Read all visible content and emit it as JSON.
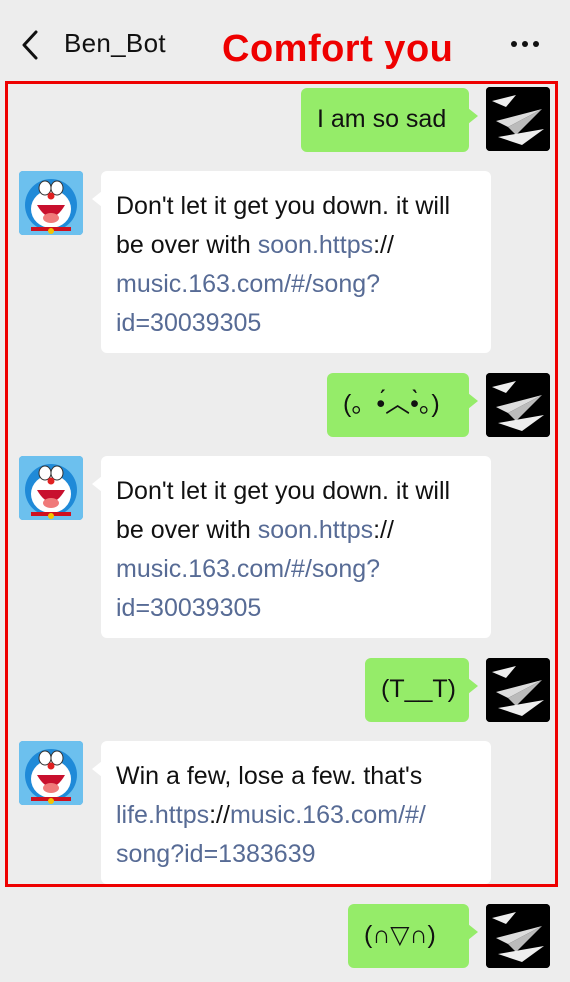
{
  "header": {
    "title": "Ben_Bot",
    "back_icon": "chevron-left-icon",
    "more_icon": "more-dots-icon"
  },
  "annotation": {
    "caption": "Comfort you",
    "color": "#ee0000"
  },
  "colors": {
    "outgoing_bubble": "#95ec69",
    "incoming_bubble": "#ffffff",
    "link": "#576b95",
    "background": "#ededed"
  },
  "messages": [
    {
      "side": "out",
      "text": "I am so sad"
    },
    {
      "side": "in",
      "line1": "Don't let it get you down. it will",
      "line2_a": "be over with ",
      "line2_link": "soon.https",
      "line2_b": "://",
      "line3": "music.163.com/#/song?",
      "line4": "id=30039305"
    },
    {
      "side": "out",
      "text": "(。•́︿•̀。)"
    },
    {
      "side": "in",
      "line1": "Don't let it get you down. it will",
      "line2_a": "be over with ",
      "line2_link": "soon.https",
      "line2_b": "://",
      "line3": "music.163.com/#/song?",
      "line4": "id=30039305"
    },
    {
      "side": "out",
      "text": "(T__T)"
    },
    {
      "side": "in",
      "line1": "Win a few, lose a few. that's",
      "line2_link": "life.https",
      "line2_b": "://",
      "line2_link2": "music.163.com/#/",
      "line3": "song?id=1383639"
    },
    {
      "side": "out",
      "text": "(∩▽∩)"
    }
  ]
}
